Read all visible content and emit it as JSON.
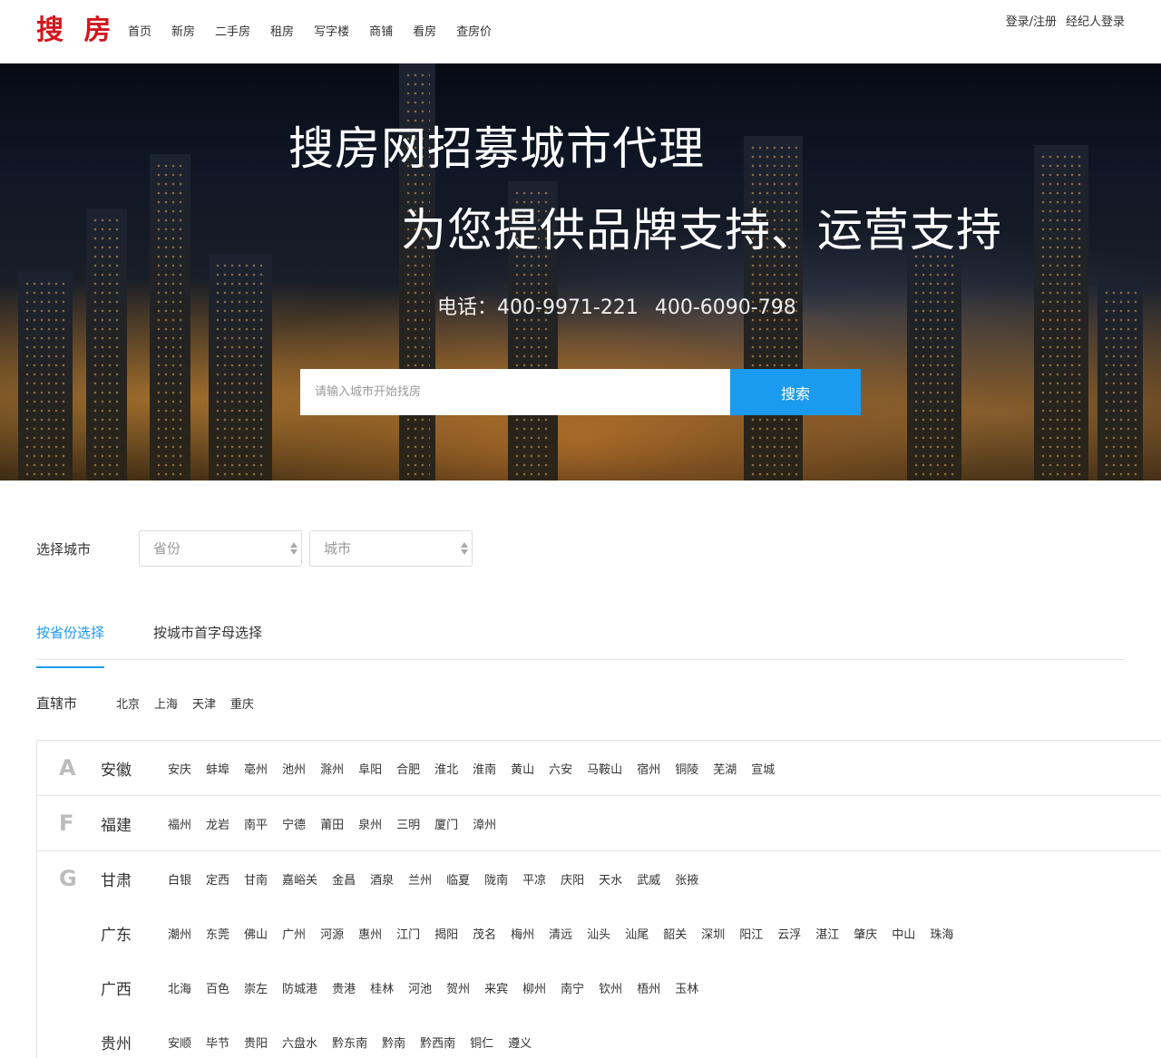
{
  "header": {
    "logo": "搜 房",
    "nav": [
      "首页",
      "新房",
      "二手房",
      "租房",
      "写字楼",
      "商铺",
      "看房",
      "查房价"
    ],
    "login": "登录/注册",
    "agent_login": "经纪人登录"
  },
  "banner": {
    "title": "搜房网招募城市代理",
    "subtitle": "为您提供品牌支持、运营支持",
    "phone_label": "电话：",
    "phone1": "400-9971-221",
    "phone2": "400-6090-798",
    "search_placeholder": "请输入城市开始找房",
    "search_button": "搜索"
  },
  "select_city": {
    "label": "选择城市",
    "province_placeholder": "省份",
    "city_placeholder": "城市"
  },
  "tabs": [
    "按省份选择",
    "按城市首字母选择"
  ],
  "municipalities": {
    "label": "直辖市",
    "cities": [
      "北京",
      "上海",
      "天津",
      "重庆"
    ]
  },
  "groups": [
    {
      "letter": "A",
      "provinces": [
        {
          "name": "安徽",
          "cities": [
            "安庆",
            "蚌埠",
            "亳州",
            "池州",
            "滁州",
            "阜阳",
            "合肥",
            "淮北",
            "淮南",
            "黄山",
            "六安",
            "马鞍山",
            "宿州",
            "铜陵",
            "芜湖",
            "宣城"
          ]
        }
      ]
    },
    {
      "letter": "F",
      "provinces": [
        {
          "name": "福建",
          "cities": [
            "福州",
            "龙岩",
            "南平",
            "宁德",
            "莆田",
            "泉州",
            "三明",
            "厦门",
            "漳州"
          ]
        }
      ]
    },
    {
      "letter": "G",
      "provinces": [
        {
          "name": "甘肃",
          "cities": [
            "白银",
            "定西",
            "甘南",
            "嘉峪关",
            "金昌",
            "酒泉",
            "兰州",
            "临夏",
            "陇南",
            "平凉",
            "庆阳",
            "天水",
            "武威",
            "张掖"
          ]
        },
        {
          "name": "广东",
          "cities": [
            "潮州",
            "东莞",
            "佛山",
            "广州",
            "河源",
            "惠州",
            "江门",
            "揭阳",
            "茂名",
            "梅州",
            "清远",
            "汕头",
            "汕尾",
            "韶关",
            "深圳",
            "阳江",
            "云浮",
            "湛江",
            "肇庆",
            "中山",
            "珠海"
          ]
        },
        {
          "name": "广西",
          "cities": [
            "北海",
            "百色",
            "崇左",
            "防城港",
            "贵港",
            "桂林",
            "河池",
            "贺州",
            "来宾",
            "柳州",
            "南宁",
            "钦州",
            "梧州",
            "玉林"
          ]
        },
        {
          "name": "贵州",
          "cities": [
            "安顺",
            "毕节",
            "贵阳",
            "六盘水",
            "黔东南",
            "黔南",
            "黔西南",
            "铜仁",
            "遵义"
          ]
        }
      ]
    }
  ]
}
